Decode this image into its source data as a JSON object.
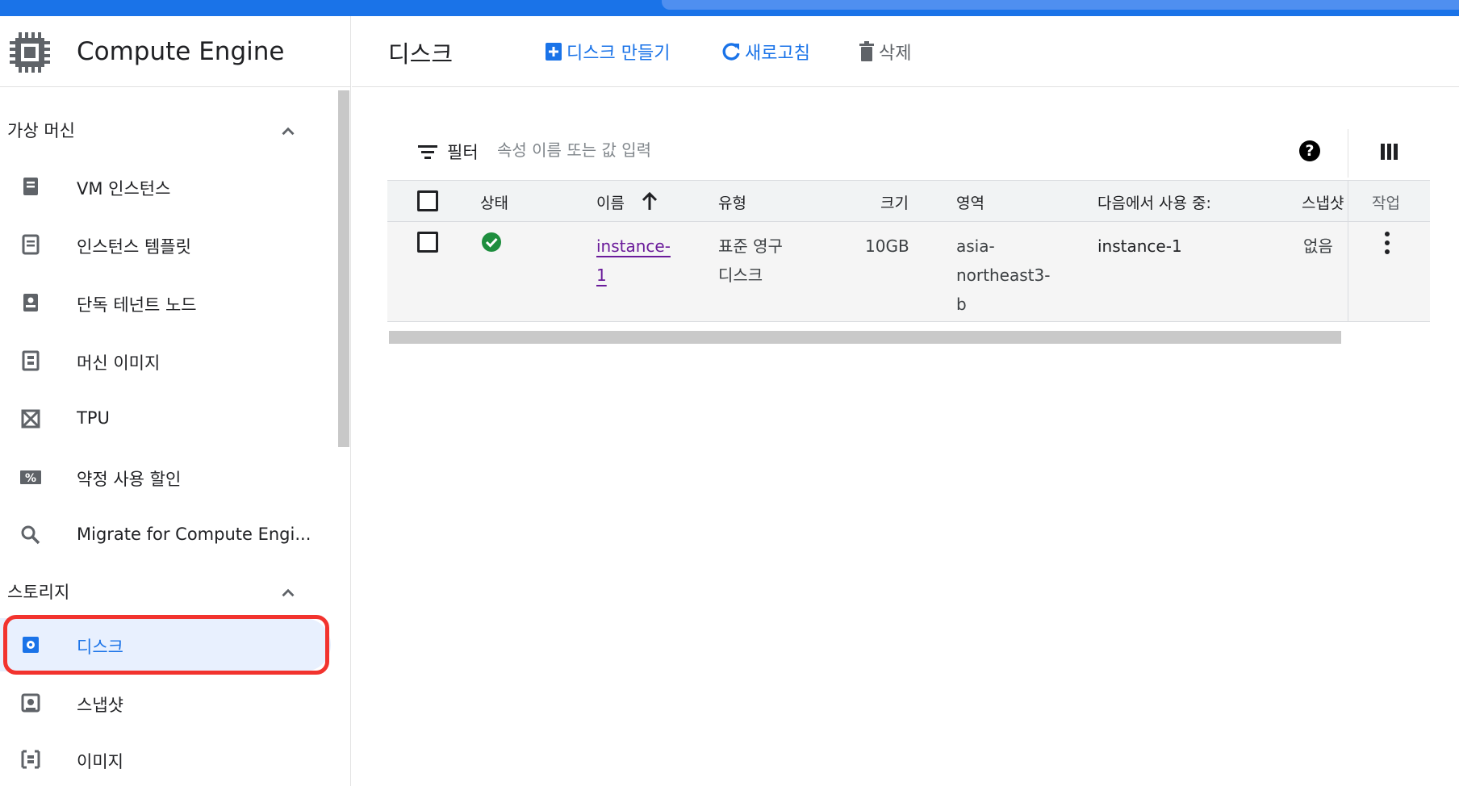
{
  "app": {
    "title": "Compute Engine"
  },
  "sidebar": {
    "sections": [
      {
        "label": "가상 머신"
      },
      {
        "label": "스토리지"
      }
    ],
    "items": [
      {
        "label": "VM 인스턴스",
        "icon": "vm-instance-icon"
      },
      {
        "label": "인스턴스 템플릿",
        "icon": "template-icon"
      },
      {
        "label": "단독 테넌트 노드",
        "icon": "sole-tenant-icon"
      },
      {
        "label": "머신 이미지",
        "icon": "machine-image-icon"
      },
      {
        "label": "TPU",
        "icon": "tpu-icon"
      },
      {
        "label": "약정 사용 할인",
        "icon": "percent-icon"
      },
      {
        "label": "Migrate for Compute Engi...",
        "icon": "search-icon"
      },
      {
        "label": "디스크",
        "icon": "disk-icon",
        "active": true
      },
      {
        "label": "스냅샷",
        "icon": "snapshot-icon"
      },
      {
        "label": "이미지",
        "icon": "image-icon"
      }
    ]
  },
  "header": {
    "title": "디스크",
    "create_label": "디스크 만들기",
    "refresh_label": "새로고침",
    "delete_label": "삭제"
  },
  "filter": {
    "label": "필터",
    "placeholder": "속성 이름 또는 값 입력"
  },
  "table": {
    "columns": {
      "status": "상태",
      "name": "이름",
      "type": "유형",
      "size": "크기",
      "zone": "영역",
      "in_use_by": "다음에서 사용 중:",
      "snapshot": "스냅샷",
      "actions": "작업"
    },
    "rows": [
      {
        "status": "ok",
        "name_line1": "instance-",
        "name_line2": "1",
        "type_line1": "표준 영구",
        "type_line2": "디스크",
        "size": "10GB",
        "zone_line1": "asia-",
        "zone_line2": "northeast3-",
        "zone_line3": "b",
        "in_use_by": "instance-1",
        "snapshot": "없음"
      }
    ]
  },
  "colors": {
    "accent": "#1a73e8",
    "active_bg": "#e8f0fe",
    "highlight": "#f2332e",
    "ok": "#1e8e3e"
  }
}
